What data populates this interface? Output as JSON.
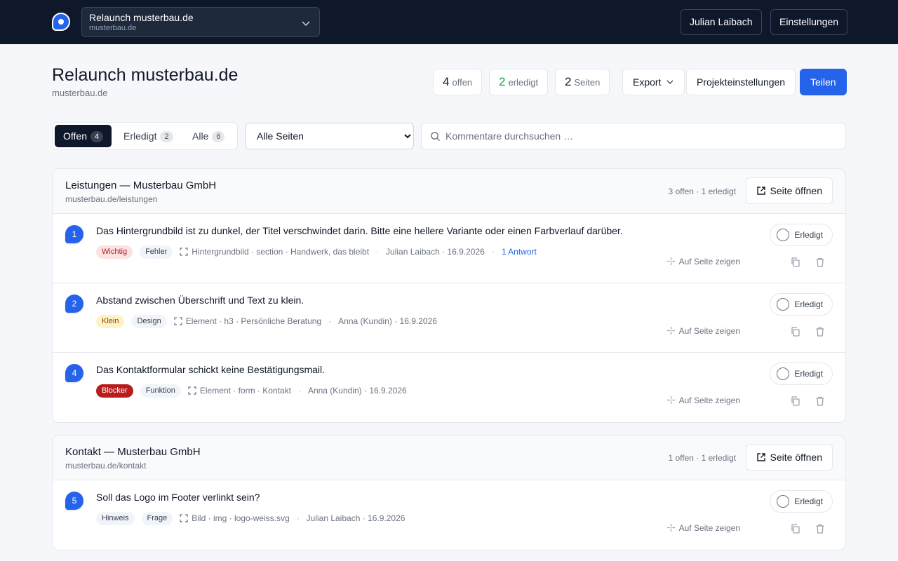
{
  "topbar": {
    "project_name": "Relaunch musterbau.de",
    "project_domain": "musterbau.de",
    "user_button": "Julian Laibach",
    "settings_button": "Einstellungen"
  },
  "header": {
    "title": "Relaunch musterbau.de",
    "subtitle": "musterbau.de",
    "stats": {
      "open_count": "4",
      "open_label": "offen",
      "done_count": "2",
      "done_label": "erledigt",
      "pages_count": "2",
      "pages_label": "Seiten"
    },
    "export_button": "Export",
    "project_settings_button": "Projekteinstellungen",
    "share_button": "Teilen"
  },
  "filters": {
    "tabs": [
      {
        "label": "Offen",
        "count": "4"
      },
      {
        "label": "Erledigt",
        "count": "2"
      },
      {
        "label": "Alle",
        "count": "6"
      }
    ],
    "page_select": "Alle Seiten",
    "search_placeholder": "Kommentare durchsuchen …"
  },
  "groups": [
    {
      "title": "Leistungen — Musterbau GmbH",
      "url": "musterbau.de/leistungen",
      "counts": "3 offen · 1 erledigt",
      "open_button": "Seite öffnen",
      "comments": [
        {
          "num": "1",
          "text": "Das Hintergrundbild ist zu dunkel, der Titel verschwindet darin. Bitte eine hellere Variante oder einen Farbverlauf darüber.",
          "priority": "Wichtig",
          "category": "Fehler",
          "target": "Hintergrundbild · section · Handwerk, das bleibt",
          "author": "Julian Laibach · 16.9.2026",
          "replies": "1 Antwort",
          "done_label": "Erledigt",
          "show_label": "Auf Seite zeigen"
        },
        {
          "num": "2",
          "text": "Abstand zwischen Überschrift und Text zu klein.",
          "priority": "Klein",
          "category": "Design",
          "target": "Element · h3 · Persönliche Beratung",
          "author": "Anna (Kundin) · 16.9.2026",
          "done_label": "Erledigt",
          "show_label": "Auf Seite zeigen"
        },
        {
          "num": "4",
          "text": "Das Kontaktformular schickt keine Bestätigungsmail.",
          "priority": "Blocker",
          "category": "Funktion",
          "target": "Element · form · Kontakt",
          "author": "Anna (Kundin) · 16.9.2026",
          "done_label": "Erledigt",
          "show_label": "Auf Seite zeigen"
        }
      ]
    },
    {
      "title": "Kontakt — Musterbau GmbH",
      "url": "musterbau.de/kontakt",
      "counts": "1 offen · 1 erledigt",
      "open_button": "Seite öffnen",
      "comments": [
        {
          "num": "5",
          "text": "Soll das Logo im Footer verlinkt sein?",
          "priority": "Hinweis",
          "category": "Frage",
          "target": "Bild · img · logo-weiss.svg",
          "author": "Julian Laibach · 16.9.2026",
          "done_label": "Erledigt",
          "show_label": "Auf Seite zeigen"
        }
      ]
    }
  ],
  "icons": [
    "app-logo-icon",
    "chevron-down-icon",
    "search-icon",
    "external-link-icon",
    "target-icon",
    "crosshair-icon",
    "copy-icon",
    "trash-icon",
    "circle-check-icon"
  ],
  "colors": {
    "topbar": "#0f172a",
    "accent": "#2563eb",
    "done_green": "#16a34a",
    "priority_wichtig": "#fde2e2",
    "priority_klein": "#fef3c7",
    "priority_blocker": "#b91c1c"
  }
}
